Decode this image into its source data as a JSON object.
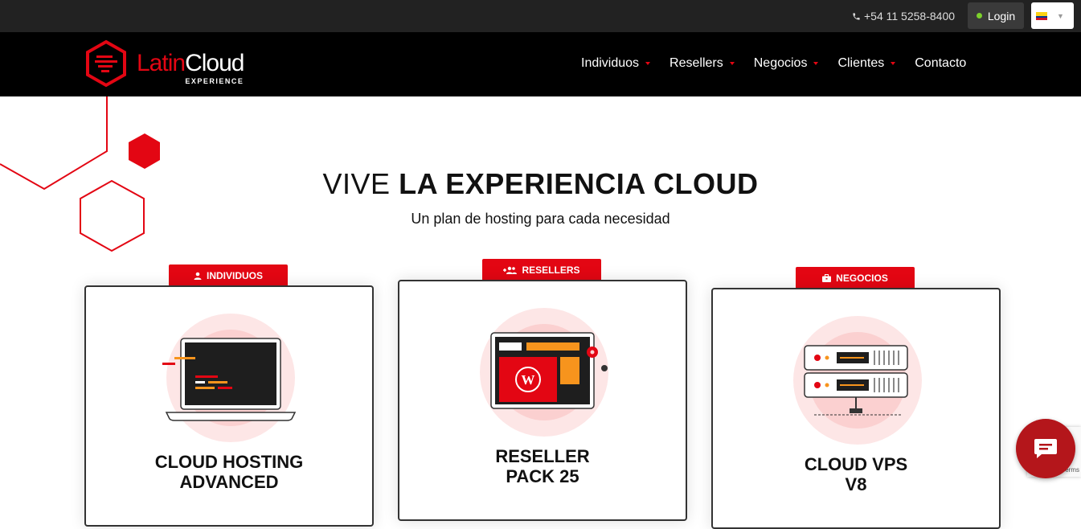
{
  "topbar": {
    "phone": "+54 11 5258-8400",
    "phone_icon": "phone-icon",
    "login_label": "Login",
    "lang_icon": "colombia-flag-icon"
  },
  "brand": {
    "logo_latin": "Latin",
    "logo_cloud": "Cloud",
    "logo_sub": "EXPERIENCE"
  },
  "nav": {
    "items": [
      {
        "label": "Individuos",
        "has_dropdown": true
      },
      {
        "label": "Resellers",
        "has_dropdown": true
      },
      {
        "label": "Negocios",
        "has_dropdown": true
      },
      {
        "label": "Clientes",
        "has_dropdown": true
      },
      {
        "label": "Contacto",
        "has_dropdown": false
      }
    ]
  },
  "hero": {
    "title_light": "VIVE ",
    "title_bold": "LA EXPERIENCIA CLOUD",
    "subtitle": "Un plan de hosting para cada necesidad"
  },
  "cards": [
    {
      "tag": "INDIVIDUOS",
      "tag_icon": "user-icon",
      "title_line1": "CLOUD HOSTING",
      "title_line2": "ADVANCED",
      "illustration": "laptop-code-icon"
    },
    {
      "tag": "RESELLERS",
      "tag_icon": "users-add-icon",
      "title_line1": "RESELLER",
      "title_line2": "PACK 25",
      "illustration": "wordpress-window-icon"
    },
    {
      "tag": "NEGOCIOS",
      "tag_icon": "briefcase-icon",
      "title_line1": "CLOUD VPS",
      "title_line2": "V8",
      "illustration": "server-rack-icon"
    }
  ],
  "recaptcha_text": "erms",
  "colors": {
    "brand_red": "#e30613",
    "topbar_bg": "#222222",
    "nav_bg": "#000000",
    "chat_bg": "#b4161b"
  }
}
